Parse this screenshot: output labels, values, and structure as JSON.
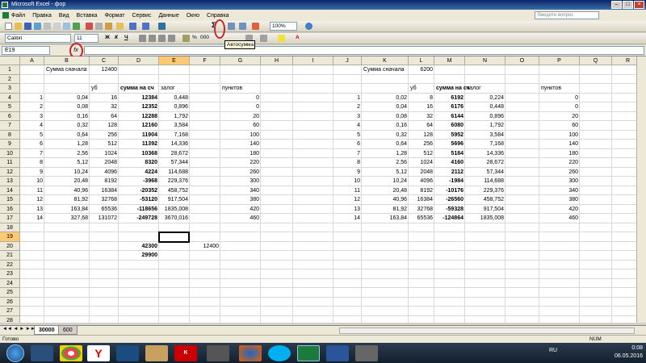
{
  "window": {
    "title": "Microsoft Excel - фор"
  },
  "menu": [
    "Файл",
    "Правка",
    "Вид",
    "Вставка",
    "Формат",
    "Сервис",
    "Данные",
    "Окно",
    "Справка"
  ],
  "help_placeholder": "Введите вопрос",
  "toolbar": {
    "zoom": "100%",
    "font": "Calibri",
    "font_size": "11",
    "bold": "Ж",
    "italic": "К",
    "underline": "Ч"
  },
  "formula_bar": {
    "name_box": "E19",
    "fx": "fx",
    "content": ""
  },
  "tooltip": "Автосумма",
  "columns": [
    "A",
    "B",
    "C",
    "D",
    "E",
    "F",
    "G",
    "H",
    "I",
    "J",
    "K",
    "L",
    "M",
    "N",
    "O",
    "P",
    "Q",
    "R",
    "S"
  ],
  "rows": [
    "1",
    "2",
    "3",
    "4",
    "5",
    "6",
    "7",
    "8",
    "9",
    "10",
    "11",
    "12",
    "13",
    "14",
    "15",
    "16",
    "17",
    "18",
    "19",
    "20",
    "21",
    "22",
    "23",
    "24",
    "25",
    "26",
    "27",
    "28"
  ],
  "cells": {
    "B1": "Сумма сначала",
    "C1": "12400",
    "K1": "Сумма сначала",
    "L1": "6200",
    "C3": "уб",
    "D3": "сумма на сч",
    "E3": "залог",
    "G3": "пунктов",
    "L3": "уб",
    "M3": "сумма на сч",
    "N3": "залог",
    "P3": "пунктов",
    "A": [
      "1",
      "2",
      "3",
      "4",
      "5",
      "6",
      "7",
      "8",
      "9",
      "10",
      "11",
      "12",
      "13",
      "14"
    ],
    "B": [
      "0,04",
      "0,08",
      "0,16",
      "0,32",
      "0,64",
      "1,28",
      "2,56",
      "5,12",
      "10,24",
      "20,48",
      "40,96",
      "81,92",
      "163,84",
      "327,68"
    ],
    "C": [
      "16",
      "32",
      "64",
      "128",
      "256",
      "512",
      "1024",
      "2048",
      "4096",
      "8192",
      "16384",
      "32768",
      "65536",
      "131072"
    ],
    "D": [
      "12384",
      "12352",
      "12288",
      "12160",
      "11904",
      "11392",
      "10368",
      "8320",
      "4224",
      "-3968",
      "-20352",
      "-53120",
      "-118656",
      "-249728"
    ],
    "E": [
      "0,448",
      "0,896",
      "1,792",
      "3,584",
      "7,168",
      "14,336",
      "28,672",
      "57,344",
      "114,688",
      "229,376",
      "458,752",
      "917,504",
      "1835,008",
      "3670,016"
    ],
    "G": [
      "0",
      "0",
      "20",
      "60",
      "100",
      "140",
      "180",
      "220",
      "260",
      "300",
      "340",
      "380",
      "420",
      "460"
    ],
    "J": [
      "1",
      "2",
      "3",
      "4",
      "5",
      "6",
      "7",
      "8",
      "9",
      "10",
      "11",
      "12",
      "13",
      "14"
    ],
    "K": [
      "0,02",
      "0,04",
      "0,08",
      "0,16",
      "0,32",
      "0,64",
      "1,28",
      "2,56",
      "5,12",
      "10,24",
      "20,48",
      "40,96",
      "81,92",
      "163,84"
    ],
    "L": [
      "8",
      "16",
      "32",
      "64",
      "128",
      "256",
      "512",
      "1024",
      "2048",
      "4096",
      "8192",
      "16384",
      "32768",
      "65536"
    ],
    "M": [
      "6192",
      "6176",
      "6144",
      "6080",
      "5952",
      "5696",
      "5184",
      "4160",
      "2112",
      "-1984",
      "-10176",
      "-26560",
      "-59328",
      "-124864"
    ],
    "N": [
      "0,224",
      "0,448",
      "0,896",
      "1,792",
      "3,584",
      "7,168",
      "14,336",
      "28,672",
      "57,344",
      "114,688",
      "229,376",
      "458,752",
      "917,504",
      "1835,008"
    ],
    "P": [
      "0",
      "0",
      "20",
      "60",
      "100",
      "140",
      "180",
      "220",
      "260",
      "300",
      "340",
      "380",
      "420",
      "460"
    ],
    "D20": "42300",
    "F20": "12400",
    "D21": "29900"
  },
  "sheets": [
    "30000",
    "600"
  ],
  "status": {
    "ready": "Готово",
    "num": "NUM"
  },
  "taskbar": {
    "lang": "RU",
    "time": "0:08",
    "date": "06.05.2016"
  }
}
